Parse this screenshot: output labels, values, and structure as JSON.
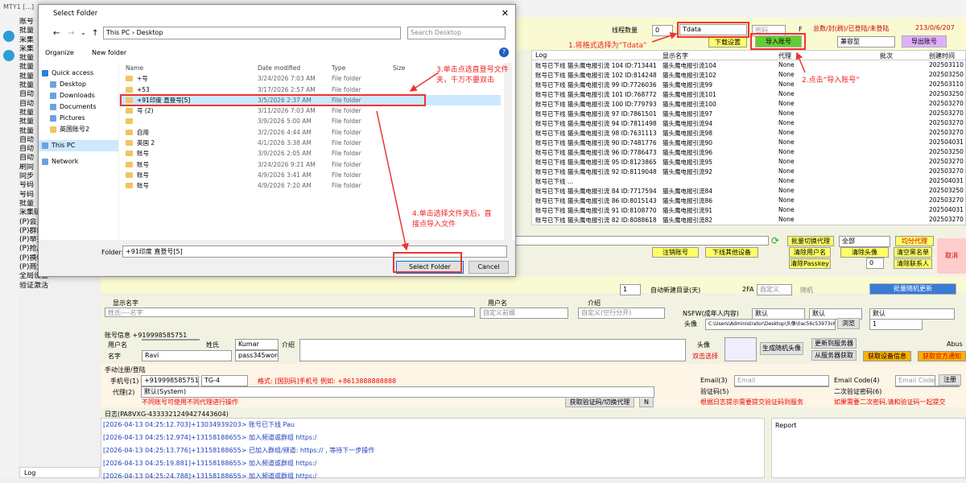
{
  "app": {
    "title": "MTY1 [...]",
    "date": "213/0/6/207",
    "stats": "总数/封(刷)/已登陆/未登陆"
  },
  "menu": [
    "账号",
    "批量",
    "采集",
    "采集",
    "批量",
    "批量",
    "批量",
    "批量",
    "自动",
    "自动",
    "批量",
    "批量",
    "批量",
    "自动",
    "自动",
    "自动",
    "刷同",
    "同步",
    "号码",
    "号码",
    "批量",
    "采集链接/消息",
    "(P)会员管理",
    "(P)群组Bot管理",
    "(P)举报链接",
    "(P)抢用户名",
    "(P)换绑手机号",
    "(P)商业功能",
    "全局设置",
    "验证激活"
  ],
  "toolbar": {
    "thread_label": "线程数量",
    "thread_value": "0",
    "format_value": "Tdata",
    "pwd_placeholder": "密码",
    "f_label": "F",
    "download_settings": "下载设置",
    "import_btn": "导入账号",
    "compat": "兼容型",
    "export_btn": "导出账号"
  },
  "grid": {
    "headers": [
      "Log",
      "显示名字",
      "代理",
      "批次",
      "创建时间"
    ],
    "rows": [
      [
        "账号已下线 猫头鹰电报引流 104 ID:713441...",
        "猫头鹰电报引流104",
        "None",
        "202503110"
      ],
      [
        "账号已下线 猫头鹰电报引流 102 ID:814248...",
        "猫头鹰电报引流102",
        "None",
        "202503250"
      ],
      [
        "账号已下线 猫头鹰电报引流 99 ID:7726036...",
        "猫头鹰电报引流99",
        "None",
        "202503110"
      ],
      [
        "账号已下线 猫头鹰电报引流 101 ID:768772...",
        "猫头鹰电报引流101",
        "None",
        "202503250"
      ],
      [
        "账号已下线 猫头鹰电报引流 100 ID:779793...",
        "猫头鹰电报引流100",
        "None",
        "202503270"
      ],
      [
        "账号已下线 猫头鹰电报引流 97 ID:7861501...",
        "猫头鹰电报引流97",
        "None",
        "202503270"
      ],
      [
        "账号已下线 猫头鹰电报引流 94 ID:7811498...",
        "猫头鹰电报引流94",
        "None",
        "202503270"
      ],
      [
        "账号已下线 猫头鹰电报引流 98 ID:7631113...",
        "猫头鹰电报引流98",
        "None",
        "202503270"
      ],
      [
        "账号已下线 猫头鹰电报引流 90 ID:7481776...",
        "猫头鹰电报引流90",
        "None",
        "202504031"
      ],
      [
        "账号已下线 猫头鹰电报引流 96 ID:7786473...",
        "猫头鹰电报引流96",
        "None",
        "202503250"
      ],
      [
        "账号已下线 猫头鹰电报引流 95 ID:8123865...",
        "猫头鹰电报引流95",
        "None",
        "202503270"
      ],
      [
        "账号已下线 猫头鹰电报引流 92 ID:8119048...",
        "猫头鹰电报引流92",
        "None",
        "202503270"
      ],
      [
        "账号已下线 ...",
        "",
        "None",
        "202504031"
      ],
      [
        "账号已下线 猫头鹰电报引流 84 ID:7717594...",
        "猫头鹰电报引流84",
        "None",
        "202503250"
      ],
      [
        "账号已下线 猫头鹰电报引流 86 ID:8015143...",
        "猫头鹰电报引流86",
        "None",
        "202503270"
      ],
      [
        "账号已下线 猫头鹰电报引流 91 ID:8108770...",
        "猫头鹰电报引流91",
        "None",
        "202504031"
      ],
      [
        "账号已下线 猫头鹰电报引流 82 ID:8088618...",
        "猫头鹰电报引流82",
        "None",
        "202503270"
      ]
    ]
  },
  "actions": {
    "batch_proxy": "批量切换代理",
    "all": "全部",
    "avg_proxy": "均分代理",
    "login_account": "注销账号",
    "logout_other": "下线其他设备",
    "clear_username": "清除用户名",
    "clear_avatar": "清除头像",
    "clear_whitelist": "清空黑名单",
    "clear_passkey": "清除Passkey",
    "clear_contacts": "清除联系人",
    "cancel": "取消",
    "batch_random": "批量随机更新",
    "stepper_1": "0",
    "stepper_2": "1",
    "auto_new": "自动新建目录(天)",
    "twofa": "2FA",
    "custom": "自定义",
    "random": "随机",
    "first_name_lbl": "用户名",
    "intro_lbl": "介绍",
    "nsfw": "NSFW(成年人内容)",
    "default": "默认",
    "avatar": "头像",
    "avatar_path": "C:\\Users\\Administrator\\Desktop\\头像\\0ac56c53973c6c881eeb9",
    "browse": "浏览",
    "abus": "Abus"
  },
  "account_info": {
    "title": "账号信息 +919998585751",
    "username_lbl": "用户名",
    "lastname_lbl": "姓氏",
    "lastname": "Kumar",
    "intro_lbl": "介绍",
    "firstname_lbl": "名字",
    "firstname": "Ravi",
    "password": "pass345word",
    "avatar_lbl": "头像",
    "dblclick": "双击选择",
    "gen_avatar": "生成随机头像",
    "update_server": "更新到服务器",
    "from_server": "从服务器获取",
    "get_device": "获取设备信息",
    "get_official": "获取官方通知"
  },
  "manual": {
    "title": "手动注册/登陆",
    "phone_lbl": "手机号(1)",
    "phone": "+919998585751",
    "tg": "TG-4",
    "format_hint": "格式: [国别码]手机号 例如: +8613888888888",
    "proxy_lbl": "代理(2)",
    "proxy": "默认(System)",
    "warn": "不同账号可使用不同代理进行操作",
    "get_code": "获取验证码/切换代理",
    "n": "N",
    "email_lbl": "Email(3)",
    "email_ph": "Email",
    "code_lbl": "验证码(5)",
    "code_hint": "根据日志提示需要提交验证码到服务",
    "email_code_lbl": "Email Code(4)",
    "email_code_ph": "Email Code",
    "second_code_lbl": "二次验证密码(6)",
    "second_hint": "如果需要二次密码,请和验证码一起提交",
    "register": "注册"
  },
  "log": {
    "title": "日志(PA8VXG-4333321249427443604)",
    "report": "Report",
    "tab": "Log",
    "lines": [
      "[2026-04-13 04:25:12.703]+13034939203> 账号已下线 Pau",
      "[2026-04-13 04:25:12.974]+13158188655> 加入频道或群组 https:/",
      "[2026-04-13 04:25:13.776]+13158188655> 已加入群组/频道: https://          , 等待下一步操作",
      "[2026-04-13 04:25:19.881]+13158188655> 加入频道或群组 https:/",
      "[2026-04-13 04:25:24.788]+13158188655> 加入频道或群组 https:/"
    ]
  },
  "dialog": {
    "title": "Select Folder",
    "path_pc": "This PC",
    "path_desktop": "Desktop",
    "search_ph": "Search Desktop",
    "organize": "Organize",
    "new_folder": "New folder",
    "tree": [
      "Quick access",
      "Desktop",
      "Downloads",
      "Documents",
      "Pictures",
      "英国账号2",
      "This PC",
      "Network"
    ],
    "cols": [
      "Name",
      "Date modified",
      "Type",
      "Size"
    ],
    "files": [
      [
        "+号",
        "3/24/2026 7:03 AM",
        "File folder"
      ],
      [
        "+53",
        "3/17/2026 2:57 AM",
        "File folder"
      ],
      [
        "+91印度 直登号[5]",
        "3/5/2026 2:37 AM",
        "File folder"
      ],
      [
        "号 (2)",
        "3/11/2026 7:03 AM",
        "File folder"
      ],
      [
        "",
        "3/9/2026 5:00 AM",
        "File folder"
      ],
      [
        "自用",
        "3/2/2026 4:44 AM",
        "File folder"
      ],
      [
        "英国        2",
        "4/1/2026 3:38 AM",
        "File folder"
      ],
      [
        "账号",
        "3/9/2026 2:05 AM",
        "File folder"
      ],
      [
        "账号",
        "3/24/2026 9:21 AM",
        "File folder"
      ],
      [
        "账号",
        "4/9/2026 3:41 AM",
        "File folder"
      ],
      [
        "账号",
        "4/9/2026 7:20 AM",
        "File folder"
      ]
    ],
    "folder_lbl": "Folder:",
    "folder_value": "+91印度 直登号[5]",
    "select_btn": "Select Folder",
    "cancel_btn": "Cancel"
  },
  "annotations": {
    "a1": "1.将格式选择为“Tdata”",
    "a2": "2.点击“导入账号”",
    "a3": "3.单击点选直登号文件夹，千万不要双击",
    "a4": "4.单击选择文件夹后，直接点导入文件"
  },
  "colors": {
    "annotation": "#e33333",
    "selected": "#cce8ff",
    "import_green": "#66cc33",
    "yellow": "#ffff66"
  }
}
